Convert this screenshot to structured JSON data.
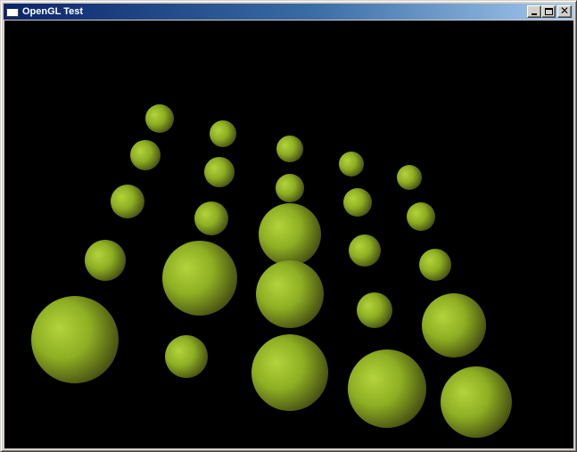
{
  "window": {
    "title": "OpenGL Test",
    "icon": "window-app-icon"
  },
  "caption_buttons": {
    "minimize_icon": "minimize-icon",
    "maximize_icon": "maximize-icon",
    "close_icon": "close-icon",
    "close_glyph": "✕"
  },
  "scene": {
    "background_color": "#000000",
    "sphere_color_light": "#b4d33c",
    "sphere_color_mid": "#8eaf22",
    "sphere_color_dark": "#3e4410",
    "sphere_count": 25
  }
}
